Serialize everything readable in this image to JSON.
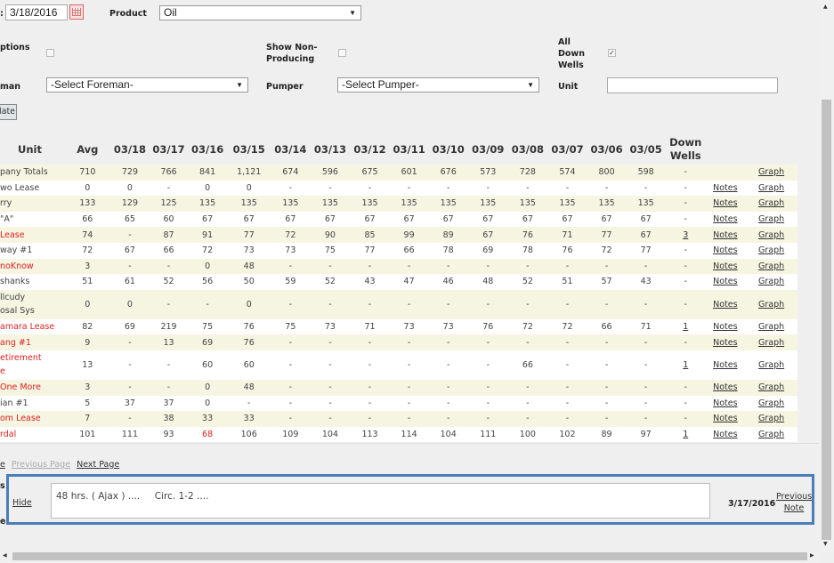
{
  "filters": {
    "date_label_fragment": ":",
    "date_value": "3/18/2016",
    "product_label": "Product",
    "product_value": "Oil",
    "options_label": "ptions",
    "show_non_producing_label": "Show Non-Producing",
    "all_down_wells_label": "All Down Wells",
    "all_down_wells_checked": true,
    "foreman_label": "man",
    "foreman_value": "-Select Foreman-",
    "pumper_label": "Pumper",
    "pumper_value": "-Select Pumper-",
    "unit_label": "Unit",
    "unit_value": "",
    "update_button": "late"
  },
  "table": {
    "headers": [
      "Unit",
      "Avg",
      "03/18",
      "03/17",
      "03/16",
      "03/15",
      "03/14",
      "03/13",
      "03/12",
      "03/11",
      "03/10",
      "03/09",
      "03/08",
      "03/07",
      "03/06",
      "03/05",
      "Down Wells"
    ],
    "notes_label": "Notes",
    "graph_label": "Graph",
    "rows": [
      {
        "name": "pany Totals",
        "red": false,
        "avg": "710",
        "values": [
          "729",
          "766",
          "841",
          "1,121",
          "674",
          "596",
          "675",
          "601",
          "676",
          "573",
          "728",
          "574",
          "800",
          "598"
        ],
        "down": "-",
        "notes": false
      },
      {
        "name": "wo Lease",
        "red": false,
        "avg": "0",
        "values": [
          "0",
          "-",
          "0",
          "0",
          "-",
          "-",
          "-",
          "-",
          "-",
          "-",
          "-",
          "-",
          "-",
          "-"
        ],
        "down": "-",
        "notes": true
      },
      {
        "name": "rry",
        "red": false,
        "avg": "133",
        "values": [
          "129",
          "125",
          "135",
          "135",
          "135",
          "135",
          "135",
          "135",
          "135",
          "135",
          "135",
          "135",
          "135",
          "135"
        ],
        "down": "-",
        "notes": true
      },
      {
        "name": "\"A\"",
        "red": false,
        "avg": "66",
        "values": [
          "65",
          "60",
          "67",
          "67",
          "67",
          "67",
          "67",
          "67",
          "67",
          "67",
          "67",
          "67",
          "67",
          "67"
        ],
        "down": "-",
        "notes": true
      },
      {
        "name": "Lease",
        "red": true,
        "avg": "74",
        "values": [
          "-",
          "87",
          "91",
          "77",
          "72",
          "90",
          "85",
          "99",
          "89",
          "67",
          "76",
          "71",
          "77",
          "67"
        ],
        "down": "3",
        "notes": true
      },
      {
        "name": "way #1",
        "red": false,
        "avg": "72",
        "values": [
          "67",
          "66",
          "72",
          "73",
          "73",
          "75",
          "77",
          "66",
          "78",
          "69",
          "78",
          "76",
          "72",
          "77"
        ],
        "down": "-",
        "notes": true
      },
      {
        "name": "noKnow",
        "red": true,
        "avg": "3",
        "values": [
          "-",
          "-",
          "0",
          "48",
          "-",
          "-",
          "-",
          "-",
          "-",
          "-",
          "-",
          "-",
          "-",
          "-"
        ],
        "down": "-",
        "notes": true
      },
      {
        "name": "shanks",
        "red": false,
        "avg": "51",
        "values": [
          "61",
          "52",
          "56",
          "50",
          "59",
          "52",
          "43",
          "47",
          "46",
          "48",
          "52",
          "51",
          "57",
          "43"
        ],
        "down": "-",
        "notes": true
      },
      {
        "name": "llcudy\nosal Sys",
        "red": false,
        "avg": "0",
        "values": [
          "0",
          "-",
          "-",
          "0",
          "-",
          "-",
          "-",
          "-",
          "-",
          "-",
          "-",
          "-",
          "-",
          "-"
        ],
        "down": "-",
        "notes": true
      },
      {
        "name": "amara Lease",
        "red": true,
        "avg": "82",
        "values": [
          "69",
          "219",
          "75",
          "76",
          "75",
          "73",
          "71",
          "73",
          "73",
          "76",
          "72",
          "72",
          "66",
          "71"
        ],
        "down": "1",
        "notes": true
      },
      {
        "name": "ang #1",
        "red": true,
        "avg": "9",
        "values": [
          "-",
          "13",
          "69",
          "76",
          "-",
          "-",
          "-",
          "-",
          "-",
          "-",
          "-",
          "-",
          "-",
          "-"
        ],
        "down": "-",
        "notes": true
      },
      {
        "name": "etirement\ne",
        "red": true,
        "avg": "13",
        "values": [
          "-",
          "-",
          "60",
          "60",
          "-",
          "-",
          "-",
          "-",
          "-",
          "-",
          "66",
          "-",
          "-",
          "-"
        ],
        "down": "1",
        "notes": true
      },
      {
        "name": " One More",
        "red": true,
        "avg": "3",
        "values": [
          "-",
          "-",
          "0",
          "48",
          "-",
          "-",
          "-",
          "-",
          "-",
          "-",
          "-",
          "-",
          "-",
          "-"
        ],
        "down": "-",
        "notes": true
      },
      {
        "name": "ian #1",
        "red": false,
        "avg": "5",
        "values": [
          "37",
          "37",
          "0",
          "-",
          "-",
          "-",
          "-",
          "-",
          "-",
          "-",
          "-",
          "-",
          "-",
          "-"
        ],
        "down": "-",
        "notes": true
      },
      {
        "name": "om Lease",
        "red": true,
        "avg": "7",
        "values": [
          "-",
          "38",
          "33",
          "33",
          "-",
          "-",
          "-",
          "-",
          "-",
          "-",
          "-",
          "-",
          "-",
          "-"
        ],
        "down": "-",
        "notes": true
      },
      {
        "name": "rdal",
        "red": true,
        "avg": "101",
        "values": [
          "111",
          "93",
          "68",
          "106",
          "109",
          "104",
          "113",
          "114",
          "104",
          "111",
          "100",
          "102",
          "89",
          "97"
        ],
        "down": "1",
        "notes": true,
        "red_cells": [
          2
        ]
      }
    ]
  },
  "pager": {
    "first_fragment": "e",
    "previous": "Previous Page",
    "next": "Next Page"
  },
  "note_panel": {
    "hide": "Hide",
    "text": "48 hrs. ( Ajax ) ....     Circ. 1-2 ....",
    "date": "3/17/2016",
    "previous_note": "Previous Note",
    "label_fragment_top": "s",
    "label_fragment_bottom": "e"
  },
  "colors": {
    "row_alt": "#f5f5e2",
    "red_text": "#e02020",
    "panel_border": "#4a7ebb"
  }
}
